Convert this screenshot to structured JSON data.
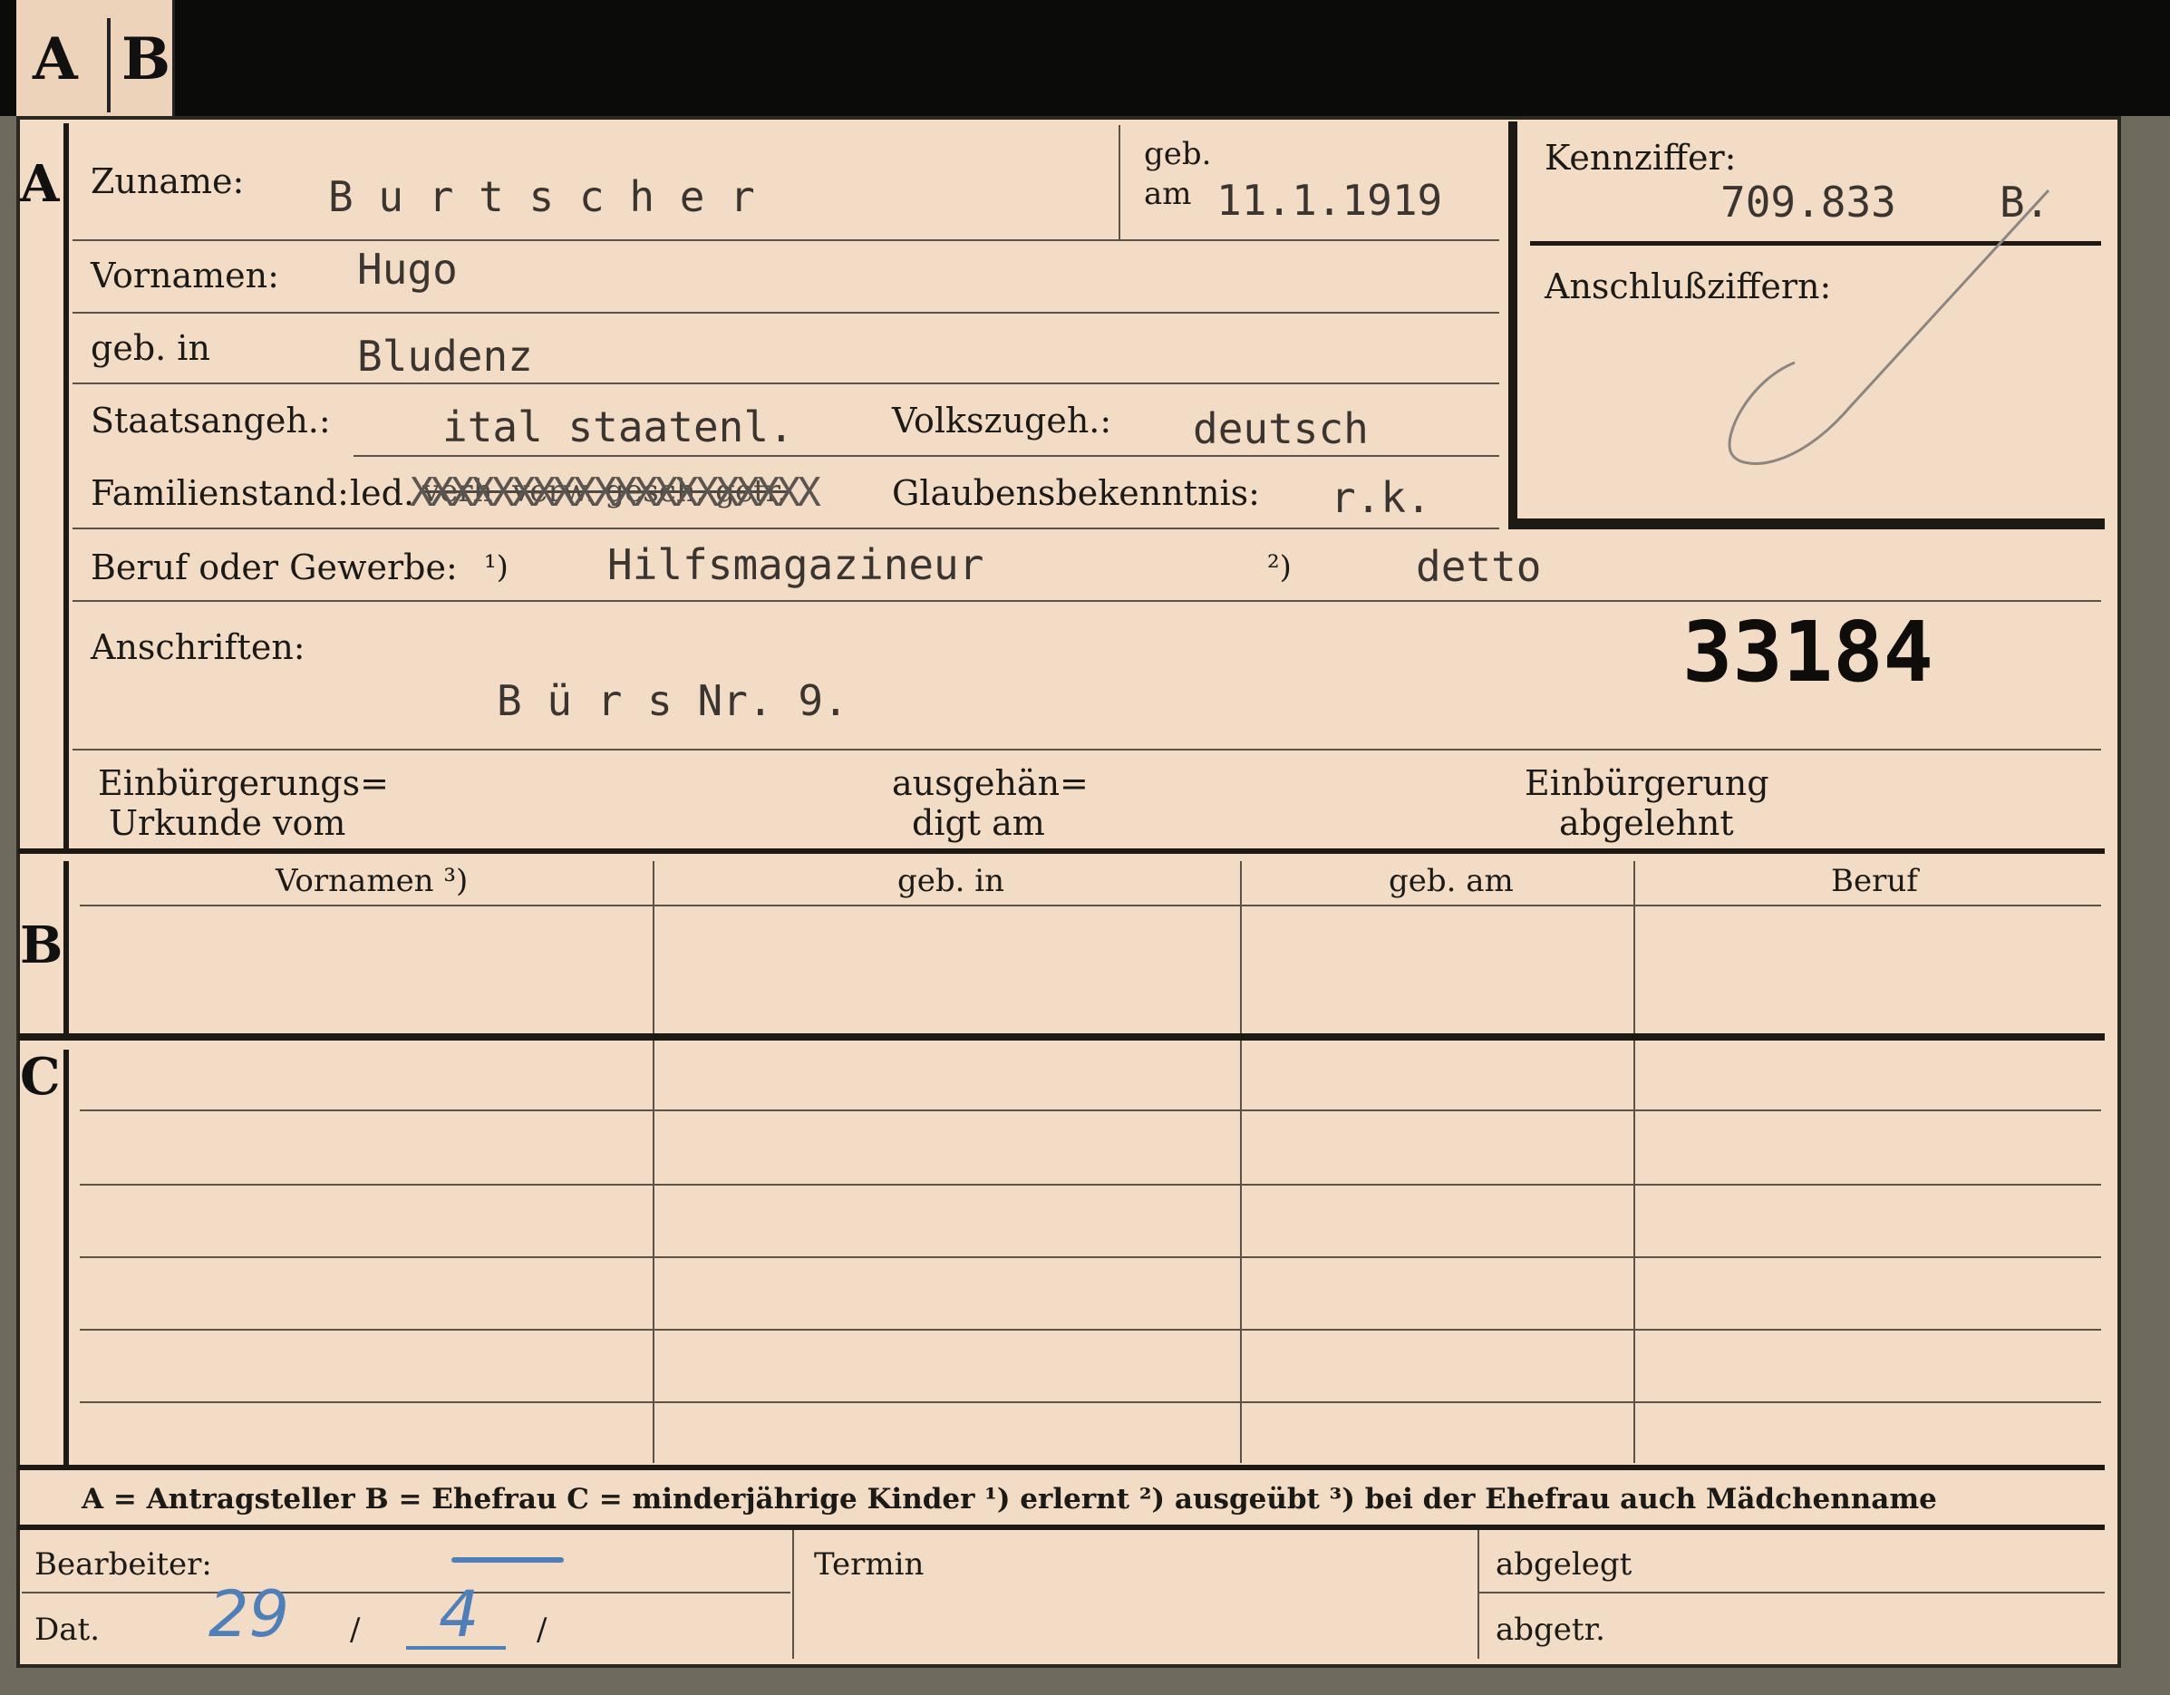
{
  "tabs": {
    "a": "A",
    "b": "B"
  },
  "sections": {
    "a": "A",
    "b": "B",
    "c": "C"
  },
  "header": {
    "surname_label": "Zuname:",
    "surname_value": "B u r t s c h e r",
    "born_label_1": "geb.",
    "born_label_2": "am",
    "born_date": "11.1.1919",
    "first_names_label": "Vornamen:",
    "first_names_value": "Hugo",
    "birthplace_label": "geb. in",
    "birthplace_value": "Bludenz",
    "citizenship_label": "Staatsangeh.:",
    "citizenship_value": "ital   staatenl.",
    "nationality_label": "Volkszugeh.:",
    "nationality_value": "deutsch",
    "marital_label": "Familienstand:",
    "marital_options": "led.",
    "marital_crossed": "verh. verw. gesch. getr.",
    "religion_label": "Glaubensbekenntnis:",
    "religion_value": "r.k.",
    "occupation_label": "Beruf oder Gewerbe:",
    "occupation_note1": "¹)",
    "occupation_value": "Hilfsmagazineur",
    "occupation_note2": "²)",
    "occupation_value2": "detto",
    "address_label": "Anschriften:",
    "address_value": "B ü r s   Nr.  9.",
    "stamp_number": "33184"
  },
  "id_box": {
    "label": "Kennziffer:",
    "value": "709.833",
    "suffix": "B.",
    "sub_label": "Anschlußziffern:"
  },
  "naturalization": {
    "col1_line1": "Einbürgerungs=",
    "col1_line2": "Urkunde vom",
    "col2_line1": "ausgehän=",
    "col2_line2": "digt am",
    "col3_line1": "Einbürgerung",
    "col3_line2": "abgelehnt"
  },
  "table": {
    "columns": [
      "Vornamen ³)",
      "geb. in",
      "geb. am",
      "Beruf"
    ]
  },
  "legend": "A = Antragsteller   B = Ehefrau   C = minderjährige Kinder   ¹) erlernt   ²) ausgeübt   ³) bei der Ehefrau auch Mädchenname",
  "footer": {
    "clerk_label": "Bearbeiter:",
    "date_label": "Dat.",
    "date_day": "29",
    "date_month": "4",
    "slash": "/",
    "deadline_label": "Termin",
    "filed_label": "abgelegt",
    "handed_label": "abgetr."
  }
}
